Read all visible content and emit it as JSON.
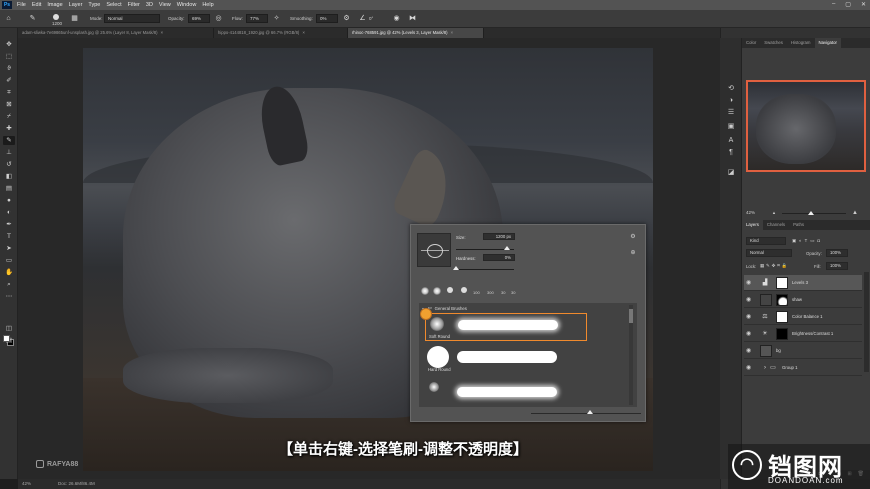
{
  "menubar": {
    "logo": "Ps",
    "items": [
      "File",
      "Edit",
      "Image",
      "Layer",
      "Type",
      "Select",
      "Filter",
      "3D",
      "View",
      "Window",
      "Help"
    ],
    "controls": [
      "–",
      "▢",
      "✕"
    ]
  },
  "options": {
    "brush_size": "1200",
    "mode_label": "Mode:",
    "mode_value": "Normal",
    "opacity_label": "Opacity:",
    "opacity_value": "69%",
    "flow_label": "Flow:",
    "flow_value": "77%",
    "smoothing_label": "Smoothing:",
    "smoothing_value": "0%",
    "angle_value": "0°"
  },
  "tabs": [
    {
      "label": "adam-sliwka-7e69865unf-unsplash.jpg @ 25.6% (Layer 8, Layer Mask/8)",
      "active": false
    },
    {
      "label": "hippo-4144818_1920.jpg @ 66.7% (RGB/8)",
      "active": false
    },
    {
      "label": "rhinoc-768591.jpg @ 42% (Levels 3, Layer Mask/8)",
      "active": true
    }
  ],
  "brush_popup": {
    "size_label": "Size:",
    "size_value": "1200 px",
    "hardness_label": "Hardness:",
    "hardness_value": "0%",
    "recent_nums": [
      "100",
      "300",
      "30",
      "30"
    ],
    "folder_label": "General Brushes",
    "brushes": [
      {
        "name": "Soft Round",
        "selected": true
      },
      {
        "name": "Hard Round",
        "selected": false
      },
      {
        "name": "",
        "selected": false
      }
    ]
  },
  "subtitle": "【单击右键-选择笔刷-调整不透明度】",
  "credit": "RAFYA88",
  "site": {
    "name": "铛图网",
    "url": "DOANDOAN.com"
  },
  "statusbar": {
    "zoom": "42%",
    "doc": "Doc: 26.6M/86.4M"
  },
  "right_panels": {
    "top_tabs": [
      "Color",
      "Swatches",
      "Histogram",
      "Navigator"
    ],
    "active_top_tab": "Navigator",
    "nav_zoom": "42%",
    "layer_tabs": [
      "Layers",
      "Channels",
      "Paths"
    ],
    "active_layer_tab": "Layers",
    "kind_label": "Kind",
    "blend_mode": "Normal",
    "opacity_label": "Opacity:",
    "opacity_value": "100%",
    "lock_label": "Lock:",
    "fill_label": "Fill:",
    "fill_value": "100%",
    "layers": [
      {
        "name": "Levels 3",
        "selected": true
      },
      {
        "name": "shaw",
        "selected": false
      },
      {
        "name": "Color Balance 1",
        "selected": false
      },
      {
        "name": "Brightness/Contrast 1",
        "selected": false
      },
      {
        "name": "bg",
        "selected": false
      },
      {
        "name": "Group 1",
        "selected": false
      }
    ]
  }
}
